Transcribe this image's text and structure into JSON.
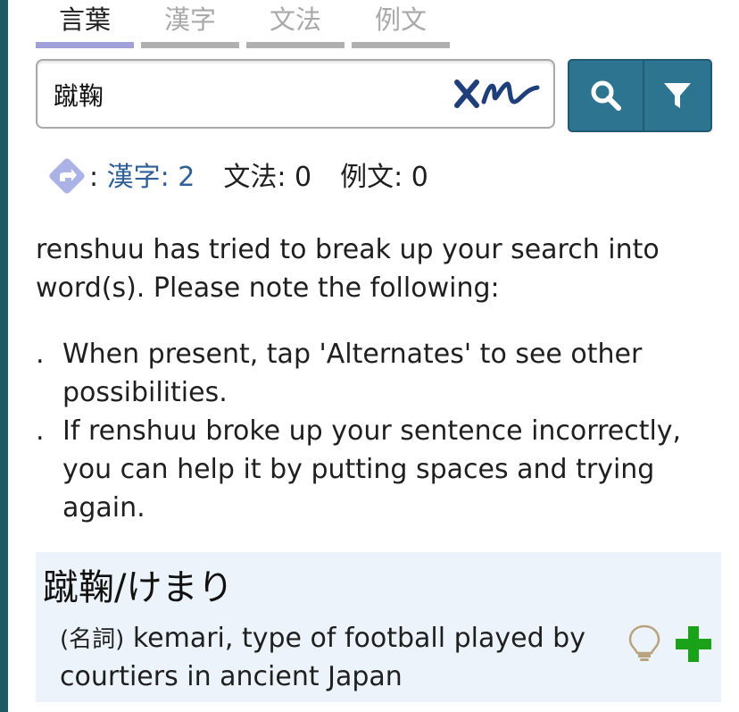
{
  "tabs": [
    {
      "label": "言葉",
      "active": true
    },
    {
      "label": "漢字",
      "active": false
    },
    {
      "label": "文法",
      "active": false
    },
    {
      "label": "例文",
      "active": false
    }
  ],
  "search": {
    "value": "蹴鞠",
    "handwriting_icon": "handwriting-icon",
    "search_icon": "search-icon",
    "filter_icon": "filter-icon"
  },
  "counts": {
    "icon": "diamond-arrow-icon",
    "colon": ":",
    "kanji_label": "漢字: 2",
    "grammar_label": "文法: 0",
    "sentences_label": "例文: 0"
  },
  "notice": {
    "text": "renshuu has tried to break up your search into word(s). Please note the following:",
    "bullet_marker": ".",
    "bullets": [
      "When present, tap 'Alternates' to see other possibilities.",
      "If renshuu broke up your sentence incorrectly, you can help it by putting spaces and trying again."
    ]
  },
  "result": {
    "word": "蹴鞠/けまり",
    "part_of_speech": "(名詞)",
    "definition": " kemari, type of football played by courtiers in ancient Japan",
    "bulb_icon": "lightbulb-icon",
    "add_icon": "plus-icon"
  },
  "colors": {
    "rail": "#1e5a66",
    "button": "#2d7490",
    "link": "#2f5f96",
    "active_tab_underline": "#a1a1d9",
    "card_bg": "#ecf3fa",
    "plus": "#1aa31a"
  }
}
